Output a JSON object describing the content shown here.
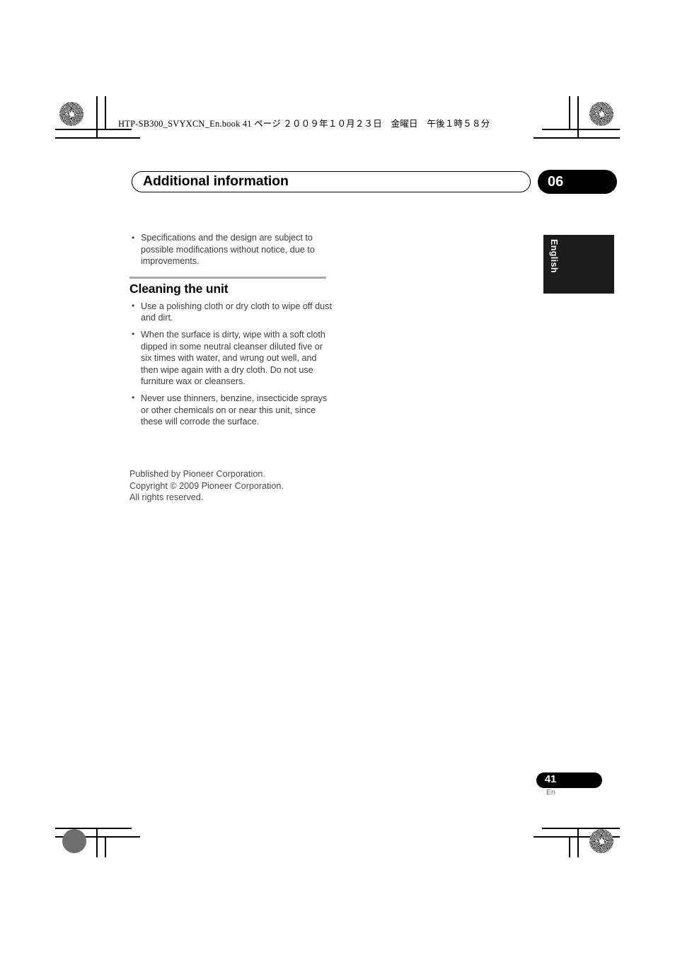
{
  "document": {
    "book_header": "HTP-SB300_SVYXCN_En.book  41 ページ  ２００９年１０月２３日　金曜日　午後１時５８分",
    "chapter_title": "Additional information",
    "chapter_number": "06",
    "language_tab": "English"
  },
  "content": {
    "intro_bullets": [
      "Specifications and the design are subject to possible modifications without notice, due to improvements."
    ],
    "section": {
      "heading": "Cleaning the unit",
      "bullets": [
        "Use a polishing cloth or dry cloth to wipe off dust and dirt.",
        "When the surface is dirty, wipe with a soft cloth dipped in some neutral cleanser diluted five or six times with water, and wrung out well, and then wipe again with a dry cloth. Do not use furniture wax or cleansers.",
        "Never use thinners, benzine, insecticide sprays or other chemicals on or near this unit, since these will corrode the surface."
      ]
    }
  },
  "colophon": {
    "line1": "Published by Pioneer Corporation.",
    "line2": "Copyright © 2009 Pioneer Corporation.",
    "line3": "All rights reserved."
  },
  "footer": {
    "page_number": "41",
    "page_language": "En"
  },
  "colors": {
    "ink": "#000000",
    "body_text": "#3d3d3d",
    "rule": "#a9a9a9",
    "tab_black": "#1c1c1c"
  }
}
